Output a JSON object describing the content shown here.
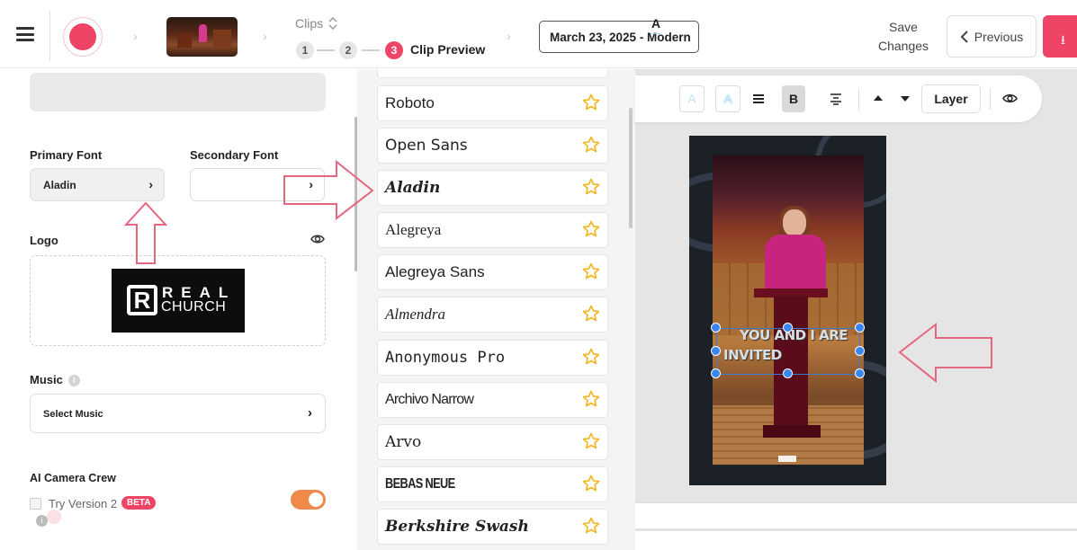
{
  "header": {
    "clips_label": "Clips",
    "steps": [
      {
        "number": "1",
        "active": false
      },
      {
        "number": "2",
        "active": false
      },
      {
        "number": "3",
        "active": true
      }
    ],
    "active_step_label": "Clip Preview",
    "clip_title": "March 23, 2025 - Modern",
    "save_label_line1": "Save",
    "save_label_line2": "Changes",
    "previous_label": "Previous",
    "accent_color": "#ee4466"
  },
  "left_panel": {
    "primary_font_label": "Primary Font",
    "primary_font_value": "Aladin",
    "secondary_font_label": "Secondary Font",
    "secondary_font_value": "",
    "logo_label": "Logo",
    "logo_text_top": "REAL",
    "logo_text_bottom": "CHURCH",
    "music_label": "Music",
    "music_select": "Select Music",
    "camera_crew_label": "AI Camera Crew",
    "try_version_label": "Try Version 2",
    "beta_badge": "BETA",
    "toggle_on": true,
    "toggle_color": "#f08a4b"
  },
  "font_list": {
    "items": [
      {
        "name": "Roboto",
        "family": "Liberation Sans",
        "style": "normal"
      },
      {
        "name": "Open Sans",
        "family": "DejaVu Sans",
        "style": "normal"
      },
      {
        "name": "Aladin",
        "family": "DejaVu Serif",
        "style": "italic-bold"
      },
      {
        "name": "Alegreya",
        "family": "Liberation Serif",
        "style": "normal"
      },
      {
        "name": "Alegreya Sans",
        "family": "Liberation Sans",
        "style": "normal"
      },
      {
        "name": "Almendra",
        "family": "Liberation Serif",
        "style": "italic"
      },
      {
        "name": "Anonymous Pro",
        "family": "DejaVu Sans Mono",
        "style": "normal"
      },
      {
        "name": "Archivo Narrow",
        "family": "Liberation Sans",
        "style": "narrow"
      },
      {
        "name": "Arvo",
        "family": "DejaVu Serif",
        "style": "normal"
      },
      {
        "name": "BEBAS NEUE",
        "family": "Liberation Sans",
        "style": "bold-narrow"
      },
      {
        "name": "Berkshire Swash",
        "family": "DejaVu Serif",
        "style": "italic-bold"
      }
    ],
    "star_color": "#f2b51c"
  },
  "preview": {
    "toolbar": {
      "text_color_icon": "A",
      "outline_icon": "A",
      "shadow_icon": "A",
      "bold_label": "B",
      "layer_label": "Layer"
    },
    "caption_line1": "YOU AND I ARE",
    "caption_line2": "INVITED"
  }
}
